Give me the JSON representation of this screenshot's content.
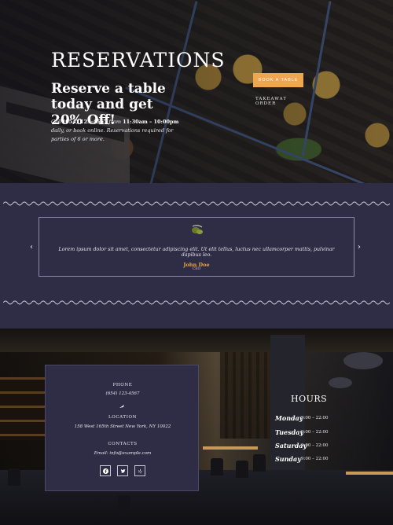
{
  "hero": {
    "title": "RESERVATIONS",
    "subtitle": "Reserve a table today and get 20% Off!",
    "info_prefix": "Call ",
    "phone": "(654) 123-4567",
    "info_mid": " from ",
    "hours": "11:30am – 10:00pm",
    "info_suffix": " daily, or book online. Reservations required for parties of 6 or more.",
    "book_button": "BOOK A TABLE",
    "takeaway_button": "TAKEAWAY ORDER",
    "accent": "#f0a64e"
  },
  "testimonial": {
    "quote": "Lorem ipsum dolor sit amet, consectetur adipiscing elit. Ut elit tellus, luctus nec ullamcorper mattis, pulvinar dapibus leo.",
    "author": "John Doe",
    "role": "CEO",
    "prev_icon": "chevron-left-icon",
    "next_icon": "chevron-right-icon",
    "icon": "olive-icon"
  },
  "contact": {
    "phone_label": "PHONE",
    "phone_value": "(654) 123-4567",
    "location_label": "LOCATION",
    "location_value": "158 West 165th Street New York, NY 10022",
    "contacts_label": "CONTACTS",
    "email_value": "Email: info@example.com",
    "social_icons": [
      "facebook-icon",
      "twitter-icon",
      "yelp-icon"
    ]
  },
  "hours": {
    "title": "HOURS",
    "rows": [
      {
        "day": "Monday",
        "time": "9:00 – 22:00"
      },
      {
        "day": "Tuesday",
        "time": "9:00 – 22:00"
      },
      {
        "day": "Saturday",
        "time": "9:00 – 22:00"
      },
      {
        "day": "Sunday",
        "time": "9:00 – 22:00"
      }
    ]
  }
}
